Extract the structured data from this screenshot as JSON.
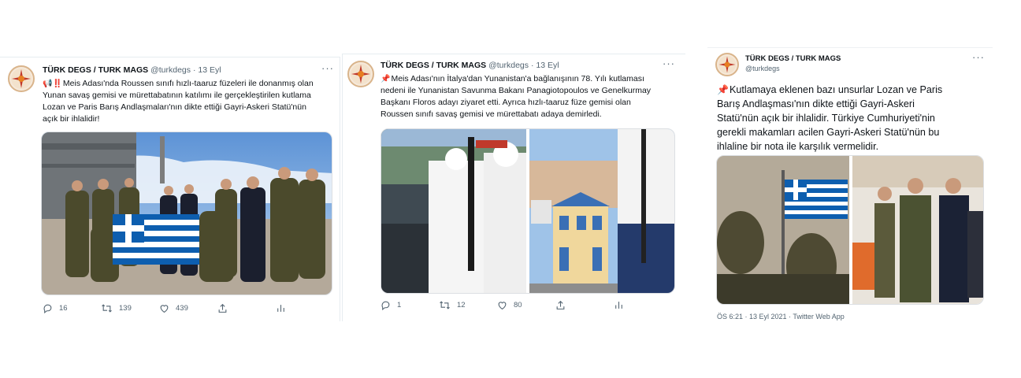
{
  "tweets": [
    {
      "name": "TÜRK DEGS / TURK MAGS",
      "handle": "@turkdegs",
      "dot": "·",
      "date": "13 Eyl",
      "more": "···",
      "lines": [
        "Meis Adası'nda Roussen sınıfı hızlı-taaruz füzeleri ile donanmış olan",
        "Yunan savaş gemisi ve mürettabatının katılımı ile gerçekleştirilen kutlama",
        "Lozan ve Paris Barış Andlaşmaları'nın dikte ettiği Gayri-Askeri Statü'nün",
        "açık bir ihlalidir!"
      ],
      "lead_emoji": "📢‼️",
      "replies": "16",
      "retweets": "139",
      "likes": "439"
    },
    {
      "name": "TÜRK DEGS / TURK MAGS",
      "handle": "@turkdegs",
      "dot": "·",
      "date": "13 Eyl",
      "more": "···",
      "lead_emoji": "📌",
      "lines": [
        "Meis Adası'nın İtalya'dan Yunanistan'a bağlanışının 78. Yılı kutlaması",
        "nedeni ile Yunanistan Savunma Bakanı Panagiotopoulos ve Genelkurmay",
        "Başkanı Floros adayı ziyaret etti. Ayrıca hızlı-taaruz füze gemisi olan",
        "Roussen sınıfı savaş gemisi ve mürettabatı adaya demirledi."
      ],
      "replies": "1",
      "retweets": "12",
      "likes": "80"
    },
    {
      "name": "TÜRK DEGS / TURK MAGS",
      "handle": "@turkdegs",
      "more": "···",
      "lead_emoji": "📌",
      "lines": [
        "Kutlamaya eklenen bazı unsurlar Lozan ve Paris",
        "Barış Andlaşması'nın dikte ettiği Gayri-Askeri",
        "Statü'nün açık bir ihlalidir. Türkiye Cumhuriyeti'nin",
        "gerekli makamları acilen Gayri-Askeri Statü'nün bu",
        "ihlaline bir nota ile karşılık vermelidir."
      ],
      "timestamp": "ÖS 6:21 · 13 Eyl 2021 · Twitter Web App"
    }
  ],
  "icons": [
    "reply-icon",
    "retweet-icon",
    "like-icon",
    "share-icon",
    "analytics-icon",
    "more-icon",
    "avatar-logo"
  ],
  "colors": {
    "text": "#0f1419",
    "secondary": "#536471",
    "border": "#e6ecf0",
    "flag_blue": "#0d5eaf",
    "pin_red": "#e0245e"
  }
}
